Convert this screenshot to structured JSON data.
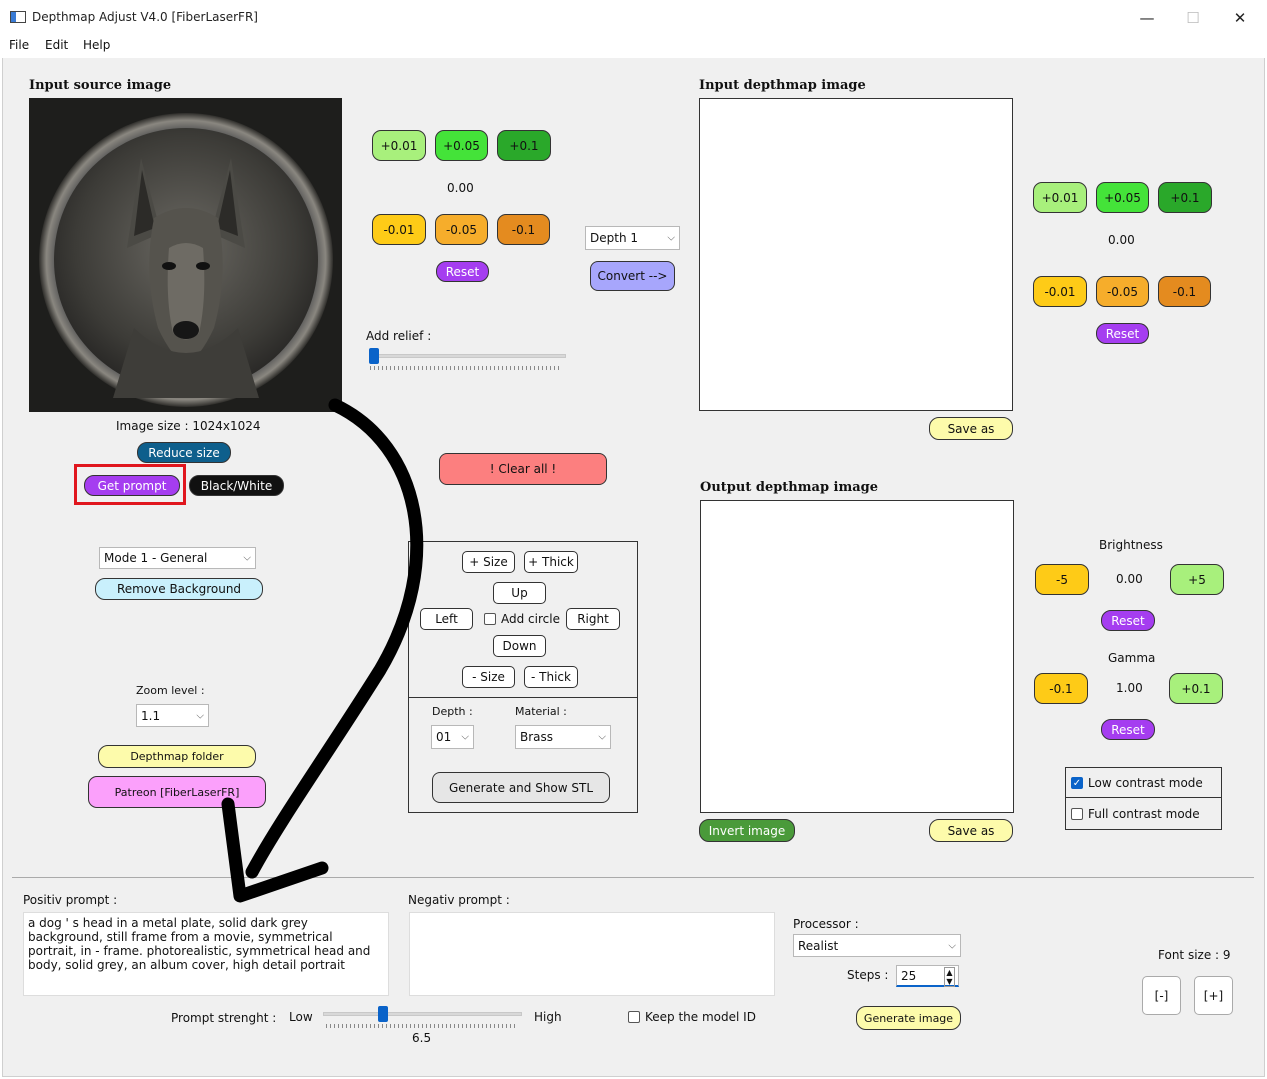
{
  "window": {
    "title": "Depthmap Adjust V4.0 [FiberLaserFR]",
    "minimize": "—",
    "maximize": "☐",
    "close": "✕"
  },
  "menu": [
    "File",
    "Edit",
    "Help"
  ],
  "source": {
    "header": "Input source image",
    "image_size": "Image size : 1024x1024",
    "reduce_size": "Reduce size",
    "get_prompt": "Get prompt",
    "black_white": "Black/White",
    "mode": "Mode 1 - General",
    "remove_bg": "Remove Background",
    "zoom_label": "Zoom level :",
    "zoom_value": "1.1",
    "depthmap_folder": "Depthmap folder",
    "patreon": "Patreon [FiberLaserFR]"
  },
  "adjust1": {
    "plus": [
      "+0.01",
      "+0.05",
      "+0.1"
    ],
    "value": "0.00",
    "minus": [
      "-0.01",
      "-0.05",
      "-0.1"
    ],
    "reset": "Reset",
    "depth_select": "Depth 1",
    "convert": "Convert -->",
    "add_relief": "Add relief :",
    "relief_level": 0.02,
    "clear_all": "!    Clear all    !"
  },
  "stl": {
    "size_plus": "+ Size",
    "thick_plus": "+ Thick",
    "up": "Up",
    "left": "Left",
    "add_circle": "Add circle",
    "right": "Right",
    "down": "Down",
    "size_minus": "- Size",
    "thick_minus": "- Thick",
    "depth_label": "Depth :",
    "depth_value": "01",
    "material_label": "Material :",
    "material_value": "Brass",
    "generate": "Generate and Show STL"
  },
  "input_depthmap": {
    "header": "Input depthmap image",
    "save_as": "Save as"
  },
  "adjust2": {
    "plus": [
      "+0.01",
      "+0.05",
      "+0.1"
    ],
    "value": "0.00",
    "minus": [
      "-0.01",
      "-0.05",
      "-0.1"
    ],
    "reset": "Reset"
  },
  "output_depthmap": {
    "header": "Output depthmap image",
    "invert": "Invert image",
    "save_as": "Save as"
  },
  "brightness": {
    "label": "Brightness",
    "minus": "-5",
    "value": "0.00",
    "plus": "+5",
    "reset": "Reset"
  },
  "gamma": {
    "label": "Gamma",
    "minus": "-0.1",
    "value": "1.00",
    "plus": "+0.1",
    "reset": "Reset"
  },
  "contrast": {
    "low": "Low contrast mode",
    "low_checked": true,
    "full": "Full contrast mode",
    "full_checked": false
  },
  "prompt": {
    "positive_label": "Positiv prompt :",
    "positive_text": "a dog ' s head in a metal plate, solid dark grey background, still frame from a movie, symmetrical portrait, in - frame. photorealistic, symmetrical head and body, solid grey, an album cover, high detail portrait",
    "negative_label": "Negativ prompt :",
    "negative_text": "",
    "strength_label": "Prompt strenght :",
    "low": "Low",
    "high": "High",
    "strength_value": "6.5",
    "strength_level": 0.3,
    "keep_model": "Keep the model ID"
  },
  "processor": {
    "label": "Processor :",
    "value": "Realist",
    "steps_label": "Steps :",
    "steps_value": "25",
    "generate": "Generate image"
  },
  "font": {
    "label": "Font size : 9",
    "minus": "[-]",
    "plus": "[+]"
  },
  "colors": {
    "highlight": "#e0161e",
    "accent": "#a53df0"
  }
}
